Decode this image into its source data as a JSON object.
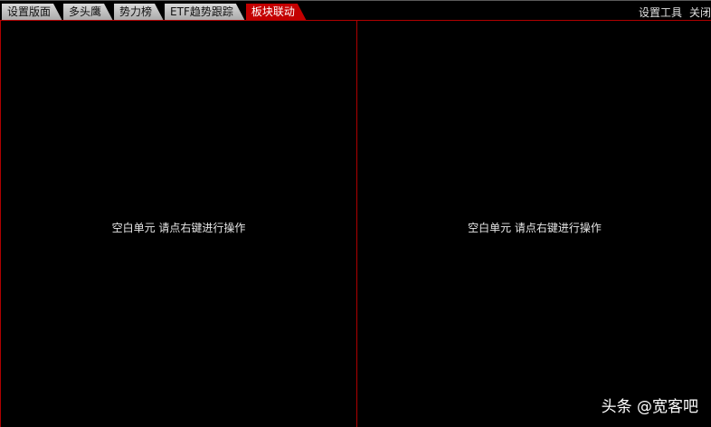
{
  "tabs": [
    {
      "label": "设置版面",
      "active": false
    },
    {
      "label": "多头鹰",
      "active": false
    },
    {
      "label": "势力榜",
      "active": false
    },
    {
      "label": "ETF趋势跟踪",
      "active": false
    },
    {
      "label": "板块联动",
      "active": true
    }
  ],
  "toolbar": {
    "settings_label": "设置工具",
    "close_label": "关闭"
  },
  "panes": {
    "left_message": "空白单元 请点右键进行操作",
    "right_message": "空白单元 请点右键进行操作"
  },
  "watermark": "头条 @宽客吧",
  "colors": {
    "background": "#000000",
    "active_tab": "#c40000",
    "divider": "#b00000"
  }
}
